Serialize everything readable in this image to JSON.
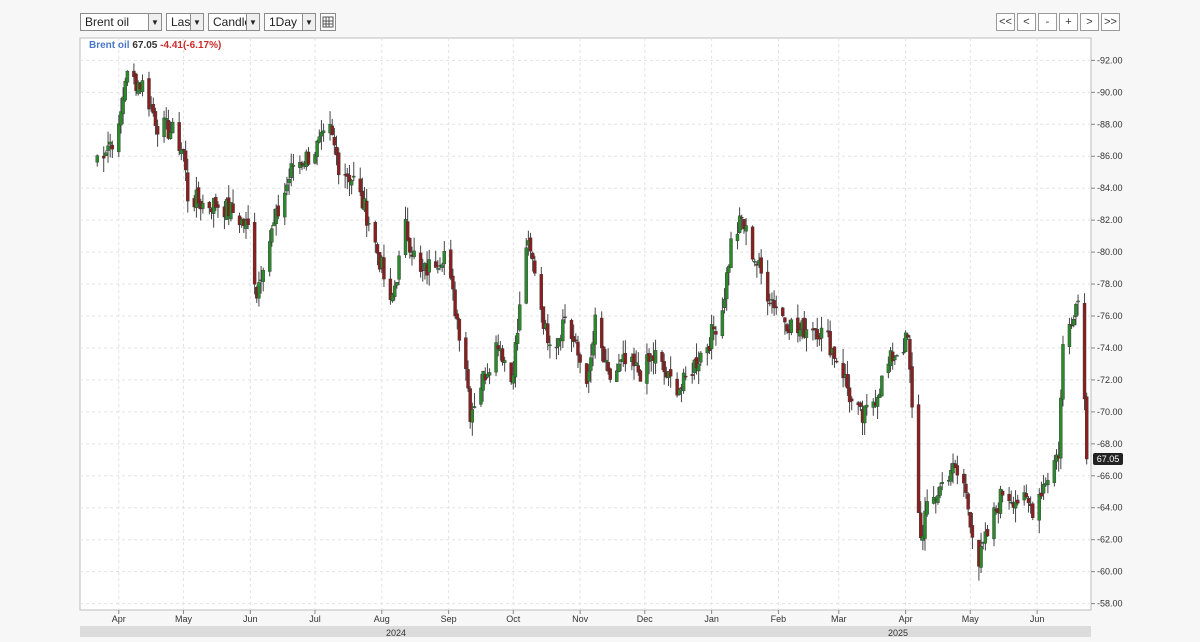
{
  "toolbar": {
    "symbol": "Brent oil",
    "price_type": "Last",
    "chart_type": "Candle",
    "interval": "1Day"
  },
  "nav": [
    "<<",
    "<",
    "-",
    "+",
    ">",
    ">>"
  ],
  "legend": {
    "name": "Brent oil",
    "value": "67.05",
    "change": "-4.41(-6.17%)"
  },
  "years": [
    "2024",
    "2025"
  ],
  "chart_data": {
    "type": "candlestick",
    "series_name": "Brent oil",
    "interval": "1Day",
    "y_ticks": [
      "58.00",
      "60.00",
      "62.00",
      "64.00",
      "66.00",
      "68.00",
      "70.00",
      "72.00",
      "74.00",
      "76.00",
      "78.00",
      "80.00",
      "82.00",
      "84.00",
      "86.00",
      "88.00",
      "90.00",
      "92.00"
    ],
    "ylim": [
      57.6,
      93.4
    ],
    "x_months": [
      "Apr",
      "May",
      "Jun",
      "Jul",
      "Aug",
      "Sep",
      "Oct",
      "Nov",
      "Dec",
      "Jan",
      "Feb",
      "Mar",
      "Apr",
      "May",
      "Jun"
    ],
    "last_price": "67.05",
    "grid": true,
    "close_path": [
      [
        "2024-03-21",
        85.8
      ],
      [
        "2024-04-01",
        87.5
      ],
      [
        "2024-04-04",
        91.0
      ],
      [
        "2024-04-12",
        90.5
      ],
      [
        "2024-04-19",
        88.0
      ],
      [
        "2024-04-26",
        87.5
      ],
      [
        "2024-05-01",
        86.3
      ],
      [
        "2024-05-03",
        83.5
      ],
      [
        "2024-05-10",
        83.0
      ],
      [
        "2024-05-17",
        83.0
      ],
      [
        "2024-05-24",
        82.5
      ],
      [
        "2024-05-31",
        81.5
      ],
      [
        "2024-06-04",
        77.5
      ],
      [
        "2024-06-07",
        79.5
      ],
      [
        "2024-06-14",
        82.5
      ],
      [
        "2024-06-21",
        85.5
      ],
      [
        "2024-06-28",
        86.0
      ],
      [
        "2024-07-05",
        87.0
      ],
      [
        "2024-07-08",
        87.5
      ],
      [
        "2024-07-12",
        85.5
      ],
      [
        "2024-07-19",
        84.5
      ],
      [
        "2024-07-26",
        82.0
      ],
      [
        "2024-08-01",
        79.0
      ],
      [
        "2024-08-05",
        76.5
      ],
      [
        "2024-08-12",
        81.5
      ],
      [
        "2024-08-19",
        78.5
      ],
      [
        "2024-08-26",
        79.5
      ],
      [
        "2024-08-30",
        80.0
      ],
      [
        "2024-09-04",
        76.5
      ],
      [
        "2024-09-09",
        73.0
      ],
      [
        "2024-09-11",
        70.0
      ],
      [
        "2024-09-18",
        72.5
      ],
      [
        "2024-09-24",
        74.5
      ],
      [
        "2024-09-30",
        72.0
      ],
      [
        "2024-10-03",
        75.0
      ],
      [
        "2024-10-07",
        80.5
      ],
      [
        "2024-10-11",
        79.0
      ],
      [
        "2024-10-16",
        75.0
      ],
      [
        "2024-10-21",
        74.5
      ],
      [
        "2024-10-25",
        76.0
      ],
      [
        "2024-10-31",
        73.5
      ],
      [
        "2024-11-05",
        72.0
      ],
      [
        "2024-11-08",
        75.5
      ],
      [
        "2024-11-14",
        72.0
      ],
      [
        "2024-11-21",
        73.0
      ],
      [
        "2024-11-29",
        72.5
      ],
      [
        "2024-12-06",
        73.5
      ],
      [
        "2024-12-12",
        72.0
      ],
      [
        "2024-12-18",
        71.5
      ],
      [
        "2024-12-24",
        73.0
      ],
      [
        "2024-12-31",
        74.5
      ],
      [
        "2025-01-06",
        76.5
      ],
      [
        "2025-01-10",
        80.5
      ],
      [
        "2025-01-15",
        82.0
      ],
      [
        "2025-01-20",
        80.0
      ],
      [
        "2025-01-27",
        77.5
      ],
      [
        "2025-02-03",
        76.0
      ],
      [
        "2025-02-10",
        75.0
      ],
      [
        "2025-02-17",
        75.5
      ],
      [
        "2025-02-24",
        74.5
      ],
      [
        "2025-03-03",
        72.5
      ],
      [
        "2025-03-07",
        70.5
      ],
      [
        "2025-03-12",
        69.5
      ],
      [
        "2025-03-18",
        71.0
      ],
      [
        "2025-03-26",
        73.5
      ],
      [
        "2025-04-02",
        74.5
      ],
      [
        "2025-04-04",
        70.0
      ],
      [
        "2025-04-08",
        62.0
      ],
      [
        "2025-04-10",
        63.5
      ],
      [
        "2025-04-16",
        65.0
      ],
      [
        "2025-04-22",
        66.5
      ],
      [
        "2025-04-28",
        65.5
      ],
      [
        "2025-05-05",
        60.5
      ],
      [
        "2025-05-07",
        61.5
      ],
      [
        "2025-05-12",
        63.5
      ],
      [
        "2025-05-16",
        65.0
      ],
      [
        "2025-05-23",
        64.5
      ],
      [
        "2025-05-30",
        64.0
      ],
      [
        "2025-06-04",
        65.5
      ],
      [
        "2025-06-11",
        67.5
      ],
      [
        "2025-06-13",
        74.0
      ],
      [
        "2025-06-18",
        76.5
      ],
      [
        "2025-06-20",
        77.0
      ],
      [
        "2025-06-23",
        71.5
      ],
      [
        "2025-06-24",
        67.05
      ]
    ]
  }
}
